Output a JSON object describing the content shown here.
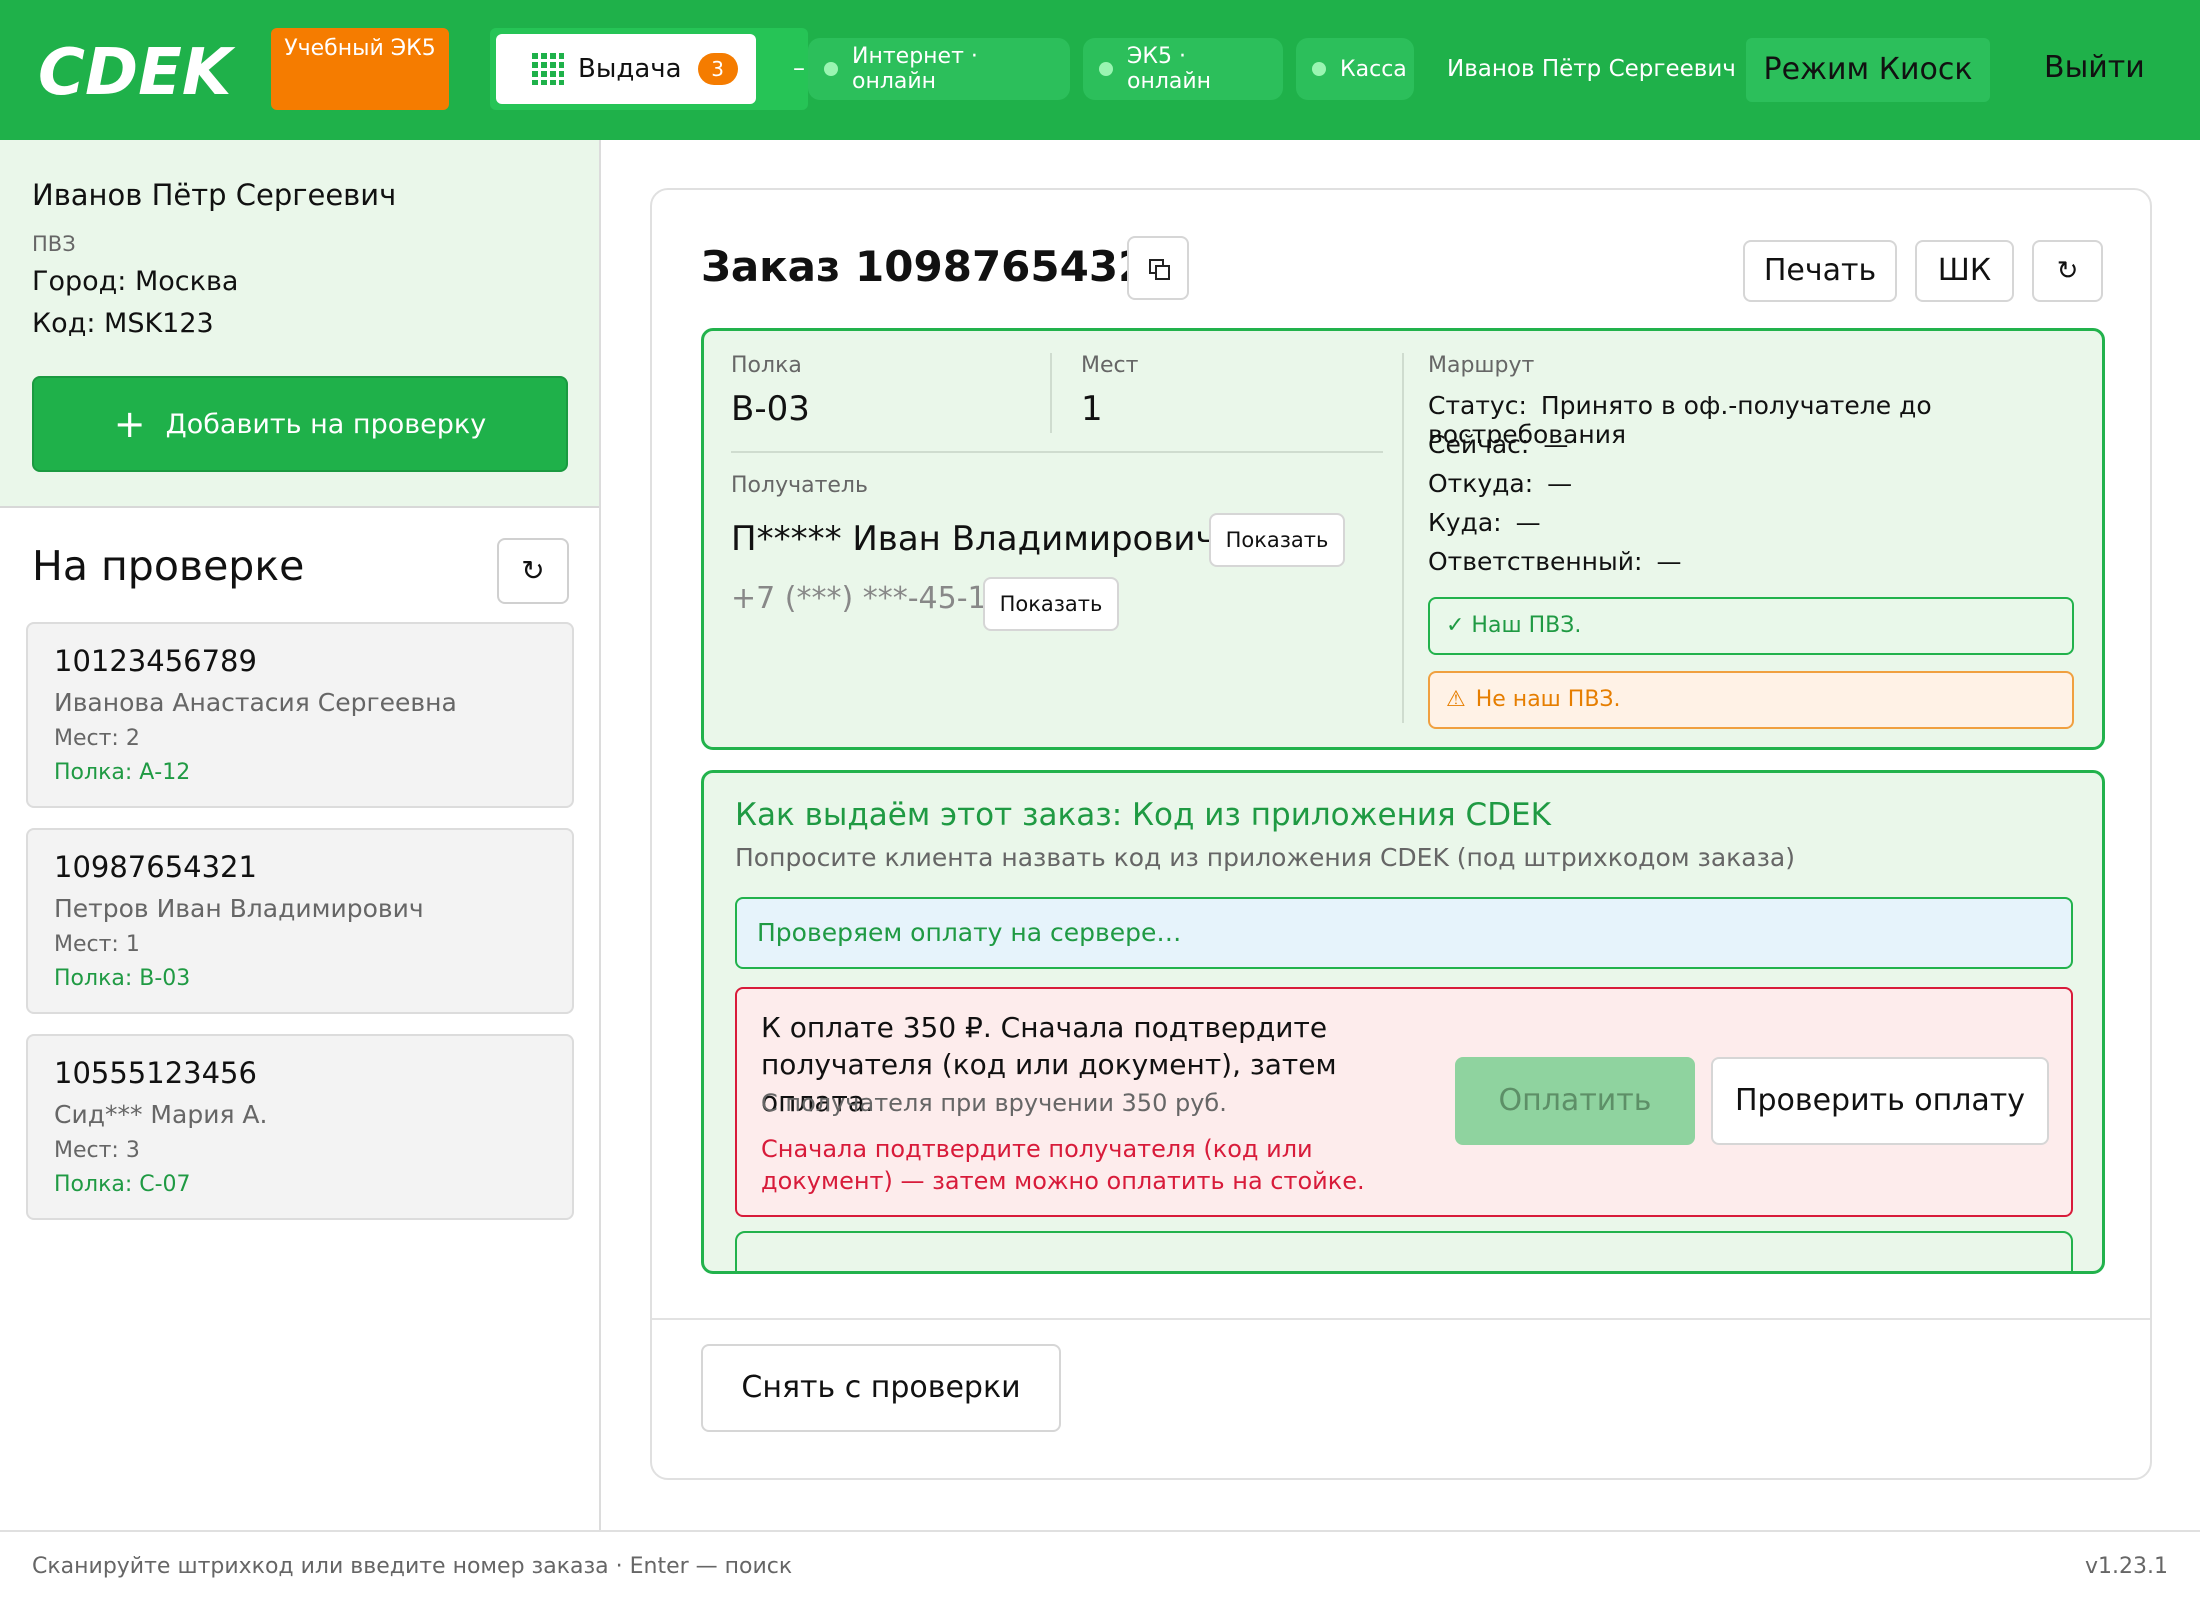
{
  "header": {
    "logo_text": "CDEK",
    "training_badge": "Учебный ЭК5",
    "tab_issue_label": "Выдача",
    "tab_issue_count": "3",
    "separator": "–",
    "status_internet": "Интернет · онлайн",
    "status_ek5": "ЭК5 · онлайн",
    "status_kassa": "Касса",
    "user_name": "Иванов Пётр Сергеевич",
    "kiosk_button": "Режим Киоск",
    "logout": "Выйти",
    "colors": {
      "brand_green": "#1fb14a",
      "training_orange": "#f57c00",
      "online_dot": "#9af5b2"
    }
  },
  "sidebar": {
    "user_name": "Иванов Пётр Сергеевич",
    "role": "ПВЗ",
    "city": "Город: Москва",
    "code": "Код: MSK123",
    "add_button": "Добавить на проверку",
    "add_icon": "plus-icon",
    "on_check_title": "На проверке",
    "refresh_icon": "refresh-icon",
    "orders": [
      {
        "number": "10123456789",
        "name": "Иванова Анастасия Сергеевна",
        "places": "Мест: 2",
        "shelf": "Полка: А-12"
      },
      {
        "number": "10987654321",
        "name": "Петров Иван Владимирович",
        "places": "Мест: 1",
        "shelf": "Полка: B-03"
      },
      {
        "number": "10555123456",
        "name": "Сид*** Мария А.",
        "places": "Мест: 3",
        "shelf": "Полка: С-07"
      }
    ]
  },
  "order": {
    "title": "Заказ 10987654321",
    "copy_icon": "copy-icon",
    "print_button": "Печать",
    "barcode_button": "ШК",
    "refresh_icon": "refresh-icon",
    "shelf_label": "Полка",
    "shelf_value": "B-03",
    "places_label": "Мест",
    "places_value": "1",
    "recipient_label": "Получатель",
    "recipient_name": "П***** Иван Владимирович",
    "phone": "+7 (***) ***-45-12",
    "show_button": "Показать",
    "route_label": "Маршрут",
    "route": [
      {
        "key": "Статус:",
        "value": "Принято в оф.-получателе до востребования"
      },
      {
        "key": "Сейчас:",
        "value": "—"
      },
      {
        "key": "Откуда:",
        "value": "—"
      },
      {
        "key": "Куда:",
        "value": "—"
      },
      {
        "key": "Ответственный:",
        "value": "—"
      }
    ],
    "our_pvz": "✓ Наш ПВЗ.",
    "not_our_pvz": "Не наш ПВЗ.",
    "warning_icon": "warning-icon"
  },
  "issue": {
    "title": "Как выдаём этот заказ: Код из приложения CDEK",
    "subtitle": "Попросите клиента назвать код из приложения CDEK (под штрихкодом заказа)",
    "checking": "Проверяем оплату на сервере…",
    "payment_main": "К оплате 350 ₽. Сначала подтвердите получателя (код или документ), затем оплата.",
    "payment_sub": "С получателя при вручении 350 руб.",
    "payment_warning": "Сначала подтвердите получателя (код или документ) — затем можно оплатить на стойке.",
    "pay_button": "Оплатить",
    "check_payment_button": "Проверить оплату"
  },
  "footer": {
    "remove_button": "Снять с проверки",
    "hint": "Сканируйте штрихкод или введите номер заказа · Enter — поиск",
    "version": "v1.23.1"
  }
}
